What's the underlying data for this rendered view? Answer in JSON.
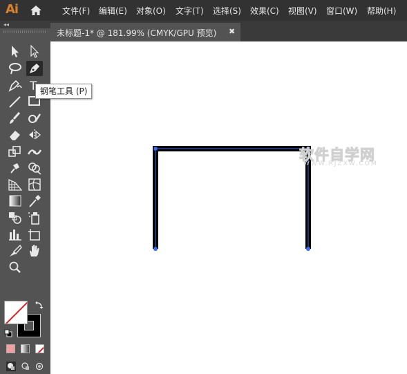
{
  "app": {
    "logo_text": "Ai",
    "brand_color": "#d9822b"
  },
  "menu": {
    "items": [
      {
        "label": "文件(F)"
      },
      {
        "label": "编辑(E)"
      },
      {
        "label": "对象(O)"
      },
      {
        "label": "文字(T)"
      },
      {
        "label": "选择(S)"
      },
      {
        "label": "效果(C)"
      },
      {
        "label": "视图(V)"
      },
      {
        "label": "窗口(W)"
      },
      {
        "label": "帮助(H)"
      }
    ]
  },
  "tools_panel": {
    "collapse_glyph": "◂◂",
    "tools": [
      {
        "name": "selection-tool-icon"
      },
      {
        "name": "direct-selection-tool-icon"
      },
      {
        "name": "lasso-tool-icon"
      },
      {
        "name": "pen-tool-icon",
        "active": true
      },
      {
        "name": "curvature-tool-icon"
      },
      {
        "name": "type-tool-icon",
        "glyph": "T"
      },
      {
        "name": "line-segment-tool-icon"
      },
      {
        "name": "rectangle-tool-icon"
      },
      {
        "name": "paintbrush-tool-icon"
      },
      {
        "name": "shaper-tool-icon"
      },
      {
        "name": "eraser-tool-icon"
      },
      {
        "name": "reflect-tool-icon"
      },
      {
        "name": "scale-tool-icon"
      },
      {
        "name": "width-tool-icon"
      },
      {
        "name": "puppet-warp-tool-icon"
      },
      {
        "name": "shape-builder-tool-icon"
      },
      {
        "name": "perspective-grid-tool-icon"
      },
      {
        "name": "mesh-tool-icon"
      },
      {
        "name": "gradient-tool-icon"
      },
      {
        "name": "eyedropper-tool-icon"
      },
      {
        "name": "blend-tool-icon"
      },
      {
        "name": "symbol-sprayer-tool-icon"
      },
      {
        "name": "column-graph-tool-icon"
      },
      {
        "name": "artboard-tool-icon"
      },
      {
        "name": "slice-tool-icon"
      },
      {
        "name": "hand-tool-icon"
      },
      {
        "name": "zoom-tool-icon"
      }
    ]
  },
  "tooltip": {
    "text": "钢笔工具 (P)"
  },
  "document_tab": {
    "title": "未标题-1* @ 181.99% (CMYK/GPU 预览)",
    "close_glyph": "✖"
  },
  "colors": {
    "fill": "#ffffff",
    "stroke": "#000000",
    "none_slash": "#e02020",
    "anchor": "#3a6cf0",
    "canvas_bg": "#ffffff",
    "ui_bg": "#535353",
    "menubar_bg": "#323232"
  },
  "watermark": {
    "text": "软件自学网",
    "sub": "WWW.RJZXW.COM"
  }
}
